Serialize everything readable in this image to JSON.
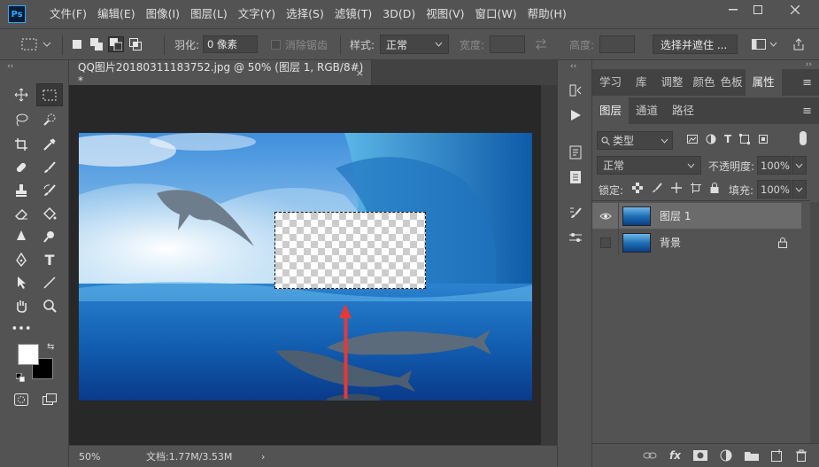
{
  "app": {
    "logo": "Ps",
    "menus": [
      "文件(F)",
      "编辑(E)",
      "图像(I)",
      "图层(L)",
      "文字(Y)",
      "选择(S)",
      "滤镜(T)",
      "3D(D)",
      "视图(V)",
      "窗口(W)",
      "帮助(H)"
    ]
  },
  "options": {
    "feather_label": "羽化:",
    "feather_value": "0 像素",
    "antialias_label": "消除锯齿",
    "style_label": "样式:",
    "style_value": "正常",
    "width_label": "宽度:",
    "height_label": "高度:",
    "select_mask_button": "选择并遮住 ..."
  },
  "document": {
    "tab_title": "QQ图片20180311183752.jpg @ 50% (图层 1, RGB/8#) *",
    "close_glyph": "×",
    "zoom": "50%",
    "doc_info": "文档:1.77M/3.53M",
    "status_arrow": "›"
  },
  "panels": {
    "top_tabs": [
      "学习",
      "库",
      "调整",
      "颜色",
      "色板",
      "属性"
    ],
    "active_top_tab": "属性",
    "layer_tabs": [
      "图层",
      "通道",
      "路径"
    ],
    "active_layer_tab": "图层",
    "filter_kind": "类型",
    "blend_mode": "正常",
    "opacity_label": "不透明度:",
    "opacity_value": "100%",
    "lock_label": "锁定:",
    "fill_label": "填充:",
    "fill_value": "100%",
    "layers": [
      {
        "name": "图层 1",
        "visible": true,
        "selected": true
      },
      {
        "name": "背景",
        "visible": false,
        "selected": false,
        "locked": true
      }
    ],
    "bottom_icons": [
      "link-icon",
      "fx-icon",
      "mask-icon",
      "adjustment-icon",
      "group-icon",
      "new-layer-icon",
      "trash-icon"
    ]
  },
  "colors": {
    "accent": "#31a8ff",
    "foreground": "#ffffff",
    "background": "#000000",
    "arrow": "#e53935"
  }
}
